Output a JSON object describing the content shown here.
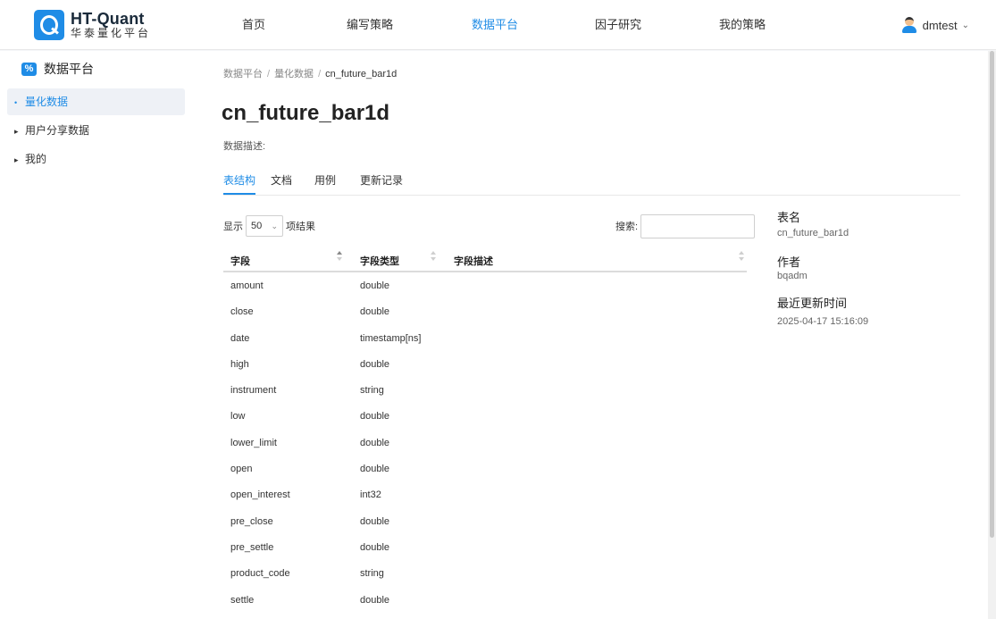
{
  "header": {
    "logo_title": "HT-Quant",
    "logo_subtitle": "华泰量化平台",
    "nav": [
      {
        "label": "首页"
      },
      {
        "label": "编写策略"
      },
      {
        "label": "数据平台"
      },
      {
        "label": "因子研究"
      },
      {
        "label": "我的策略"
      }
    ],
    "active_nav": "数据平台",
    "user": "dmtest"
  },
  "sidebar": {
    "title": "数据平台",
    "items": [
      {
        "label": "量化数据",
        "active": true
      },
      {
        "label": "用户分享数据",
        "active": false
      },
      {
        "label": "我的",
        "active": false
      }
    ]
  },
  "breadcrumb": [
    "数据平台",
    "量化数据",
    "cn_future_bar1d"
  ],
  "page_title": "cn_future_bar1d",
  "description_label": "数据描述:",
  "tabs": [
    {
      "label": "表结构",
      "active": true
    },
    {
      "label": "文档",
      "active": false
    },
    {
      "label": "用例",
      "active": false
    },
    {
      "label": "更新记录",
      "active": false
    }
  ],
  "table_controls": {
    "show_prefix": "显示",
    "page_size": "50",
    "show_suffix": "项结果",
    "search_label": "搜索:",
    "search_value": ""
  },
  "table": {
    "columns": [
      "字段",
      "字段类型",
      "字段描述"
    ],
    "rows": [
      {
        "field": "amount",
        "type": "double",
        "desc": ""
      },
      {
        "field": "close",
        "type": "double",
        "desc": ""
      },
      {
        "field": "date",
        "type": "timestamp[ns]",
        "desc": ""
      },
      {
        "field": "high",
        "type": "double",
        "desc": ""
      },
      {
        "field": "instrument",
        "type": "string",
        "desc": ""
      },
      {
        "field": "low",
        "type": "double",
        "desc": ""
      },
      {
        "field": "lower_limit",
        "type": "double",
        "desc": ""
      },
      {
        "field": "open",
        "type": "double",
        "desc": ""
      },
      {
        "field": "open_interest",
        "type": "int32",
        "desc": ""
      },
      {
        "field": "pre_close",
        "type": "double",
        "desc": ""
      },
      {
        "field": "pre_settle",
        "type": "double",
        "desc": ""
      },
      {
        "field": "product_code",
        "type": "string",
        "desc": ""
      },
      {
        "field": "settle",
        "type": "double",
        "desc": ""
      }
    ]
  },
  "meta": {
    "table_name_label": "表名",
    "table_name": "cn_future_bar1d",
    "author_label": "作者",
    "author": "bqadm",
    "updated_label": "最近更新时间",
    "updated": "2025-04-17 15:16:09"
  },
  "colors": {
    "accent": "#1f8ce6",
    "sidebar_active_bg": "#eef1f6"
  },
  "icons": {
    "logo": "q-logo-icon",
    "sidebar_title": "percent-chart-icon",
    "user_avatar": "user-avatar-icon",
    "dropdown": "chevron-down-icon",
    "sort": "sort-icon"
  }
}
